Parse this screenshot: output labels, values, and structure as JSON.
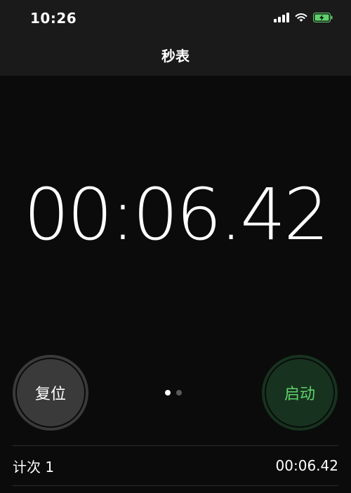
{
  "status_bar": {
    "time": "10:26",
    "icons": [
      "signal-icon",
      "wifi-icon",
      "battery-charging-icon"
    ],
    "battery_color": "#5fd26c"
  },
  "nav": {
    "title": "秒表"
  },
  "stopwatch": {
    "display_time": "00:06.42"
  },
  "controls": {
    "reset_label": "复位",
    "start_label": "启动",
    "reset_color": "#3a3a3a",
    "start_color": "#17331f",
    "start_text_color": "#5fd26c"
  },
  "pager": {
    "pages": 2,
    "active_page": 1
  },
  "laps": [
    {
      "label": "计次 1",
      "time": "00:06.42"
    }
  ]
}
